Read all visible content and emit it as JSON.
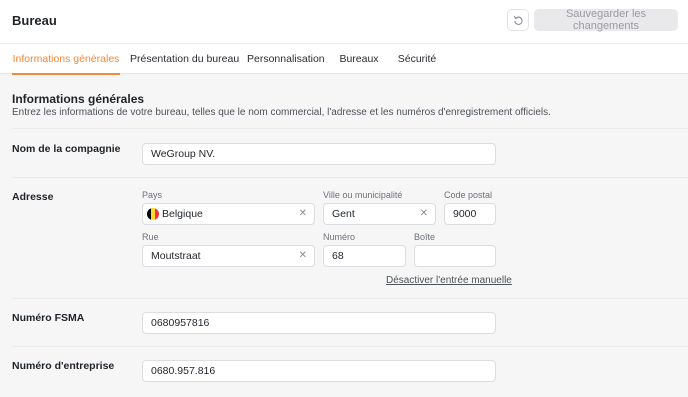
{
  "header": {
    "title": "Bureau",
    "save_label": "Sauvegarder les changements"
  },
  "tabs": [
    {
      "label": "Informations générales",
      "active": true
    },
    {
      "label": "Présentation du bureau",
      "active": false
    },
    {
      "label": "Personnalisation",
      "active": false
    },
    {
      "label": "Bureaux",
      "active": false
    },
    {
      "label": "Sécurité",
      "active": false
    }
  ],
  "section": {
    "title": "Informations générales",
    "description": "Entrez les informations de votre bureau, telles que le nom commercial, l'adresse et les numéros d'enregistrement officiels."
  },
  "company": {
    "label": "Nom de la compagnie",
    "value": "WeGroup NV."
  },
  "address": {
    "label": "Adresse",
    "country_label": "Pays",
    "country_value": "Belgique",
    "country_flag_colors": [
      "#000000",
      "#fdda24",
      "#ef3340"
    ],
    "city_label": "Ville ou municipalité",
    "city_value": "Gent",
    "postal_label": "Code postal",
    "postal_value": "9000",
    "street_label": "Rue",
    "street_value": "Moutstraat",
    "number_label": "Numéro",
    "number_value": "68",
    "box_label": "Boîte",
    "box_value": "",
    "manual_entry_link": "Désactiver l'entrée manuelle"
  },
  "fsma": {
    "label": "Numéro FSMA",
    "value": "0680957816"
  },
  "enterprise": {
    "label": "Numéro d'entreprise",
    "value": "0680.957.816"
  },
  "colors": {
    "accent": "#f08a3c"
  }
}
